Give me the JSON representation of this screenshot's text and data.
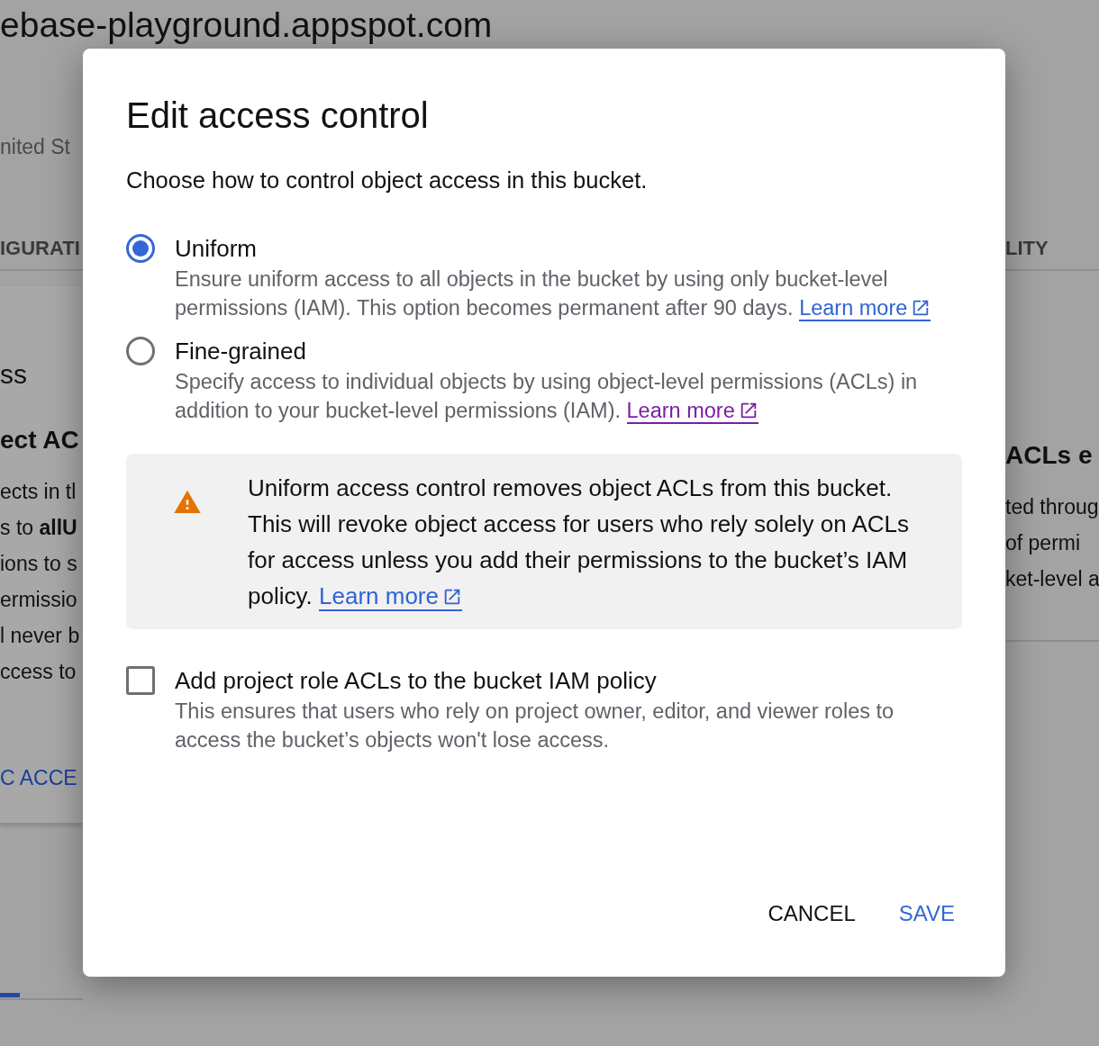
{
  "background": {
    "page_title": "ebase-playground.appspot.com",
    "left": {
      "location": "nited St",
      "tab": "IGURATI",
      "section_title": "ss",
      "heading": "ect AC",
      "lines": [
        "ects in tl",
        "s to **allU**",
        "ions to s",
        "ermissio",
        "l never b",
        "ccess to"
      ],
      "action": "C ACCE"
    },
    "right": {
      "tab": "LITY",
      "heading": "ACLs e",
      "lines": [
        "ted throug",
        "of permi",
        "ket-level a"
      ]
    }
  },
  "dialog": {
    "title": "Edit access control",
    "intro": "Choose how to control object access in this bucket.",
    "options": [
      {
        "label": "Uniform",
        "selected": true,
        "description": "Ensure uniform access to all objects in the bucket by using only bucket-level permissions (IAM). This option becomes permanent after 90 days.",
        "link": {
          "text": "Learn more",
          "visited": false
        }
      },
      {
        "label": "Fine-grained",
        "selected": false,
        "description": "Specify access to individual objects by using object-level permissions (ACLs) in addition to your bucket-level permissions (IAM).",
        "link": {
          "text": "Learn more",
          "visited": true
        }
      }
    ],
    "warning": {
      "text": "Uniform access control removes object ACLs from this bucket. This will revoke object access for users who rely solely on ACLs for access unless you add their permissions to the bucket’s IAM policy.",
      "link": {
        "text": "Learn more",
        "visited": false
      }
    },
    "checkbox": {
      "label": "Add project role ACLs to the bucket IAM policy",
      "checked": false,
      "description": "This ensures that users who rely on project owner, editor, and viewer roles to access the bucket’s objects won't lose access."
    },
    "buttons": [
      {
        "label": "CANCEL",
        "kind": "secondary"
      },
      {
        "label": "SAVE",
        "kind": "primary"
      }
    ]
  }
}
